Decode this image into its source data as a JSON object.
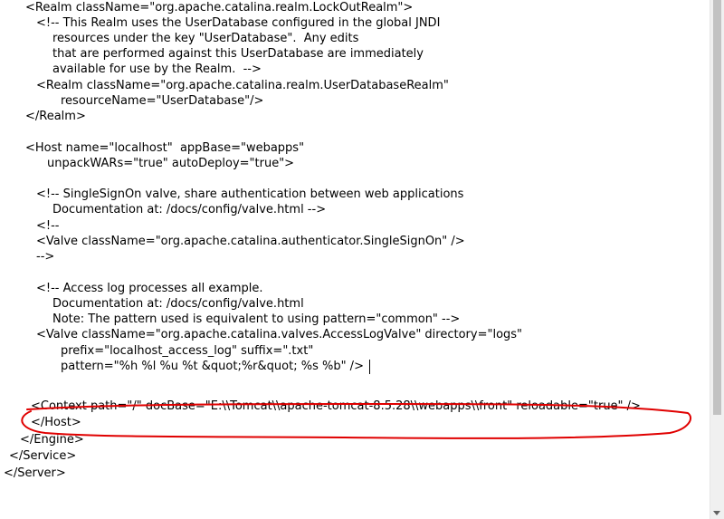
{
  "editor": {
    "lines": [
      "<Realm className=\"org.apache.catalina.realm.LockOutRealm\">",
      "<!-- This Realm uses the UserDatabase configured in the global JNDI",
      "resources under the key \"UserDatabase\".  Any edits",
      "that are performed against this UserDatabase are immediately",
      "available for use by the Realm.  -->",
      "<Realm className=\"org.apache.catalina.realm.UserDatabaseRealm\"",
      "resourceName=\"UserDatabase\"/>",
      "</Realm>",
      "<Host name=\"localhost\"  appBase=\"webapps\"",
      "unpackWARs=\"true\" autoDeploy=\"true\">",
      "<!-- SingleSignOn valve, share authentication between web applications",
      "Documentation at: /docs/config/valve.html -->",
      "<!--",
      "<Valve className=\"org.apache.catalina.authenticator.SingleSignOn\" />",
      "-->",
      "<!-- Access log processes all example.",
      "Documentation at: /docs/config/valve.html",
      "Note: The pattern used is equivalent to using pattern=\"common\" -->",
      "<Valve className=\"org.apache.catalina.valves.AccessLogValve\" directory=\"logs\"",
      "prefix=\"localhost_access_log\" suffix=\".txt\"",
      "pattern=\"%h %l %u %t &quot;%r&quot; %s %b\" />",
      "<Context path=\"/\" docBase=\"E:\\\\Tomcat\\\\apache-tomcat-8.5.28\\\\webapps\\\\front\" reloadable=\"true\" />",
      "</Host>",
      "</Engine>",
      "</Service>",
      "</Server>"
    ]
  },
  "colors": {
    "text": "#000000",
    "annotation": "#e00000",
    "background": "#ffffff"
  }
}
